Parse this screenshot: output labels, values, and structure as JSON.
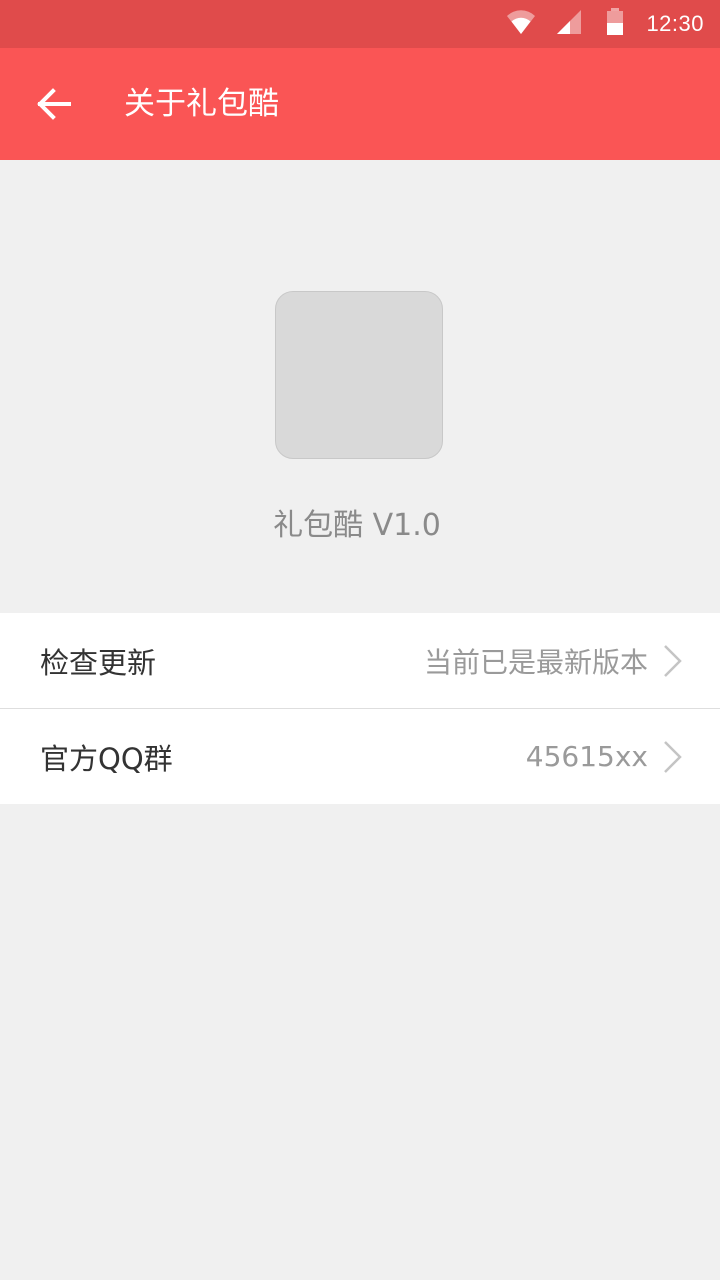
{
  "status_bar": {
    "time": "12:30",
    "icons": [
      "wifi-icon",
      "cell-signal-icon",
      "battery-icon"
    ],
    "color": "#e04b4b"
  },
  "app_bar": {
    "title": "关于礼包酷",
    "back_icon": "arrow-left-icon",
    "color": "#fa5555"
  },
  "about": {
    "logo": "app-logo-placeholder",
    "version_text": "礼包酷 V1.0"
  },
  "settings": {
    "items": [
      {
        "label": "检查更新",
        "value": "当前已是最新版本",
        "icon": "chevron-right-icon"
      },
      {
        "label": "官方QQ群",
        "value": "45615xx",
        "icon": "chevron-right-icon"
      }
    ]
  }
}
